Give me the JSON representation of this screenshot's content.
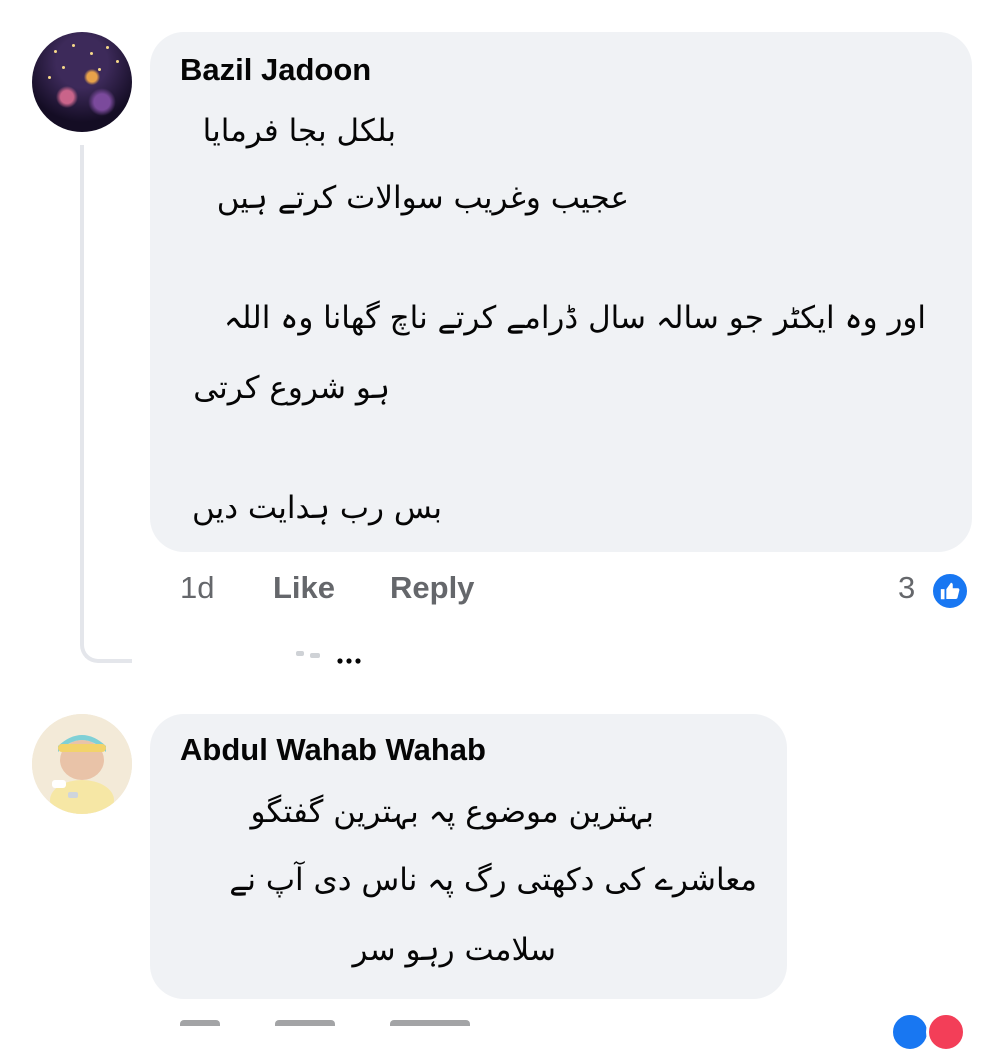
{
  "comments": [
    {
      "author": "Bazil Jadoon",
      "lines": [
        "بلکل بجا فرمایا",
        "عجیب وغریب سوالات کرتے ہیں",
        "اور وہ ایکٹر جو سالہ سال ڈرامے کرتے ناچ گھانا وہ اللہ",
        "ہو شروع کرتی",
        "بس رب ہدایت دیں"
      ],
      "time": "1d",
      "like_label": "Like",
      "reply_label": "Reply",
      "reaction_count": "3",
      "reaction_icon": "thumbs-up-icon"
    },
    {
      "author": "Abdul Wahab Wahab",
      "lines": [
        "بہترین موضوع پہ بہترین گفتگو",
        "معاشرے کی دکھتی رگ پہ ناس دی آپ نے",
        "سلامت رہو سر"
      ]
    }
  ],
  "colors": {
    "bubble": "#f0f2f5",
    "text": "#050505",
    "meta": "#65676b",
    "like_blue": "#1877f2",
    "love_red": "#f33e58"
  }
}
